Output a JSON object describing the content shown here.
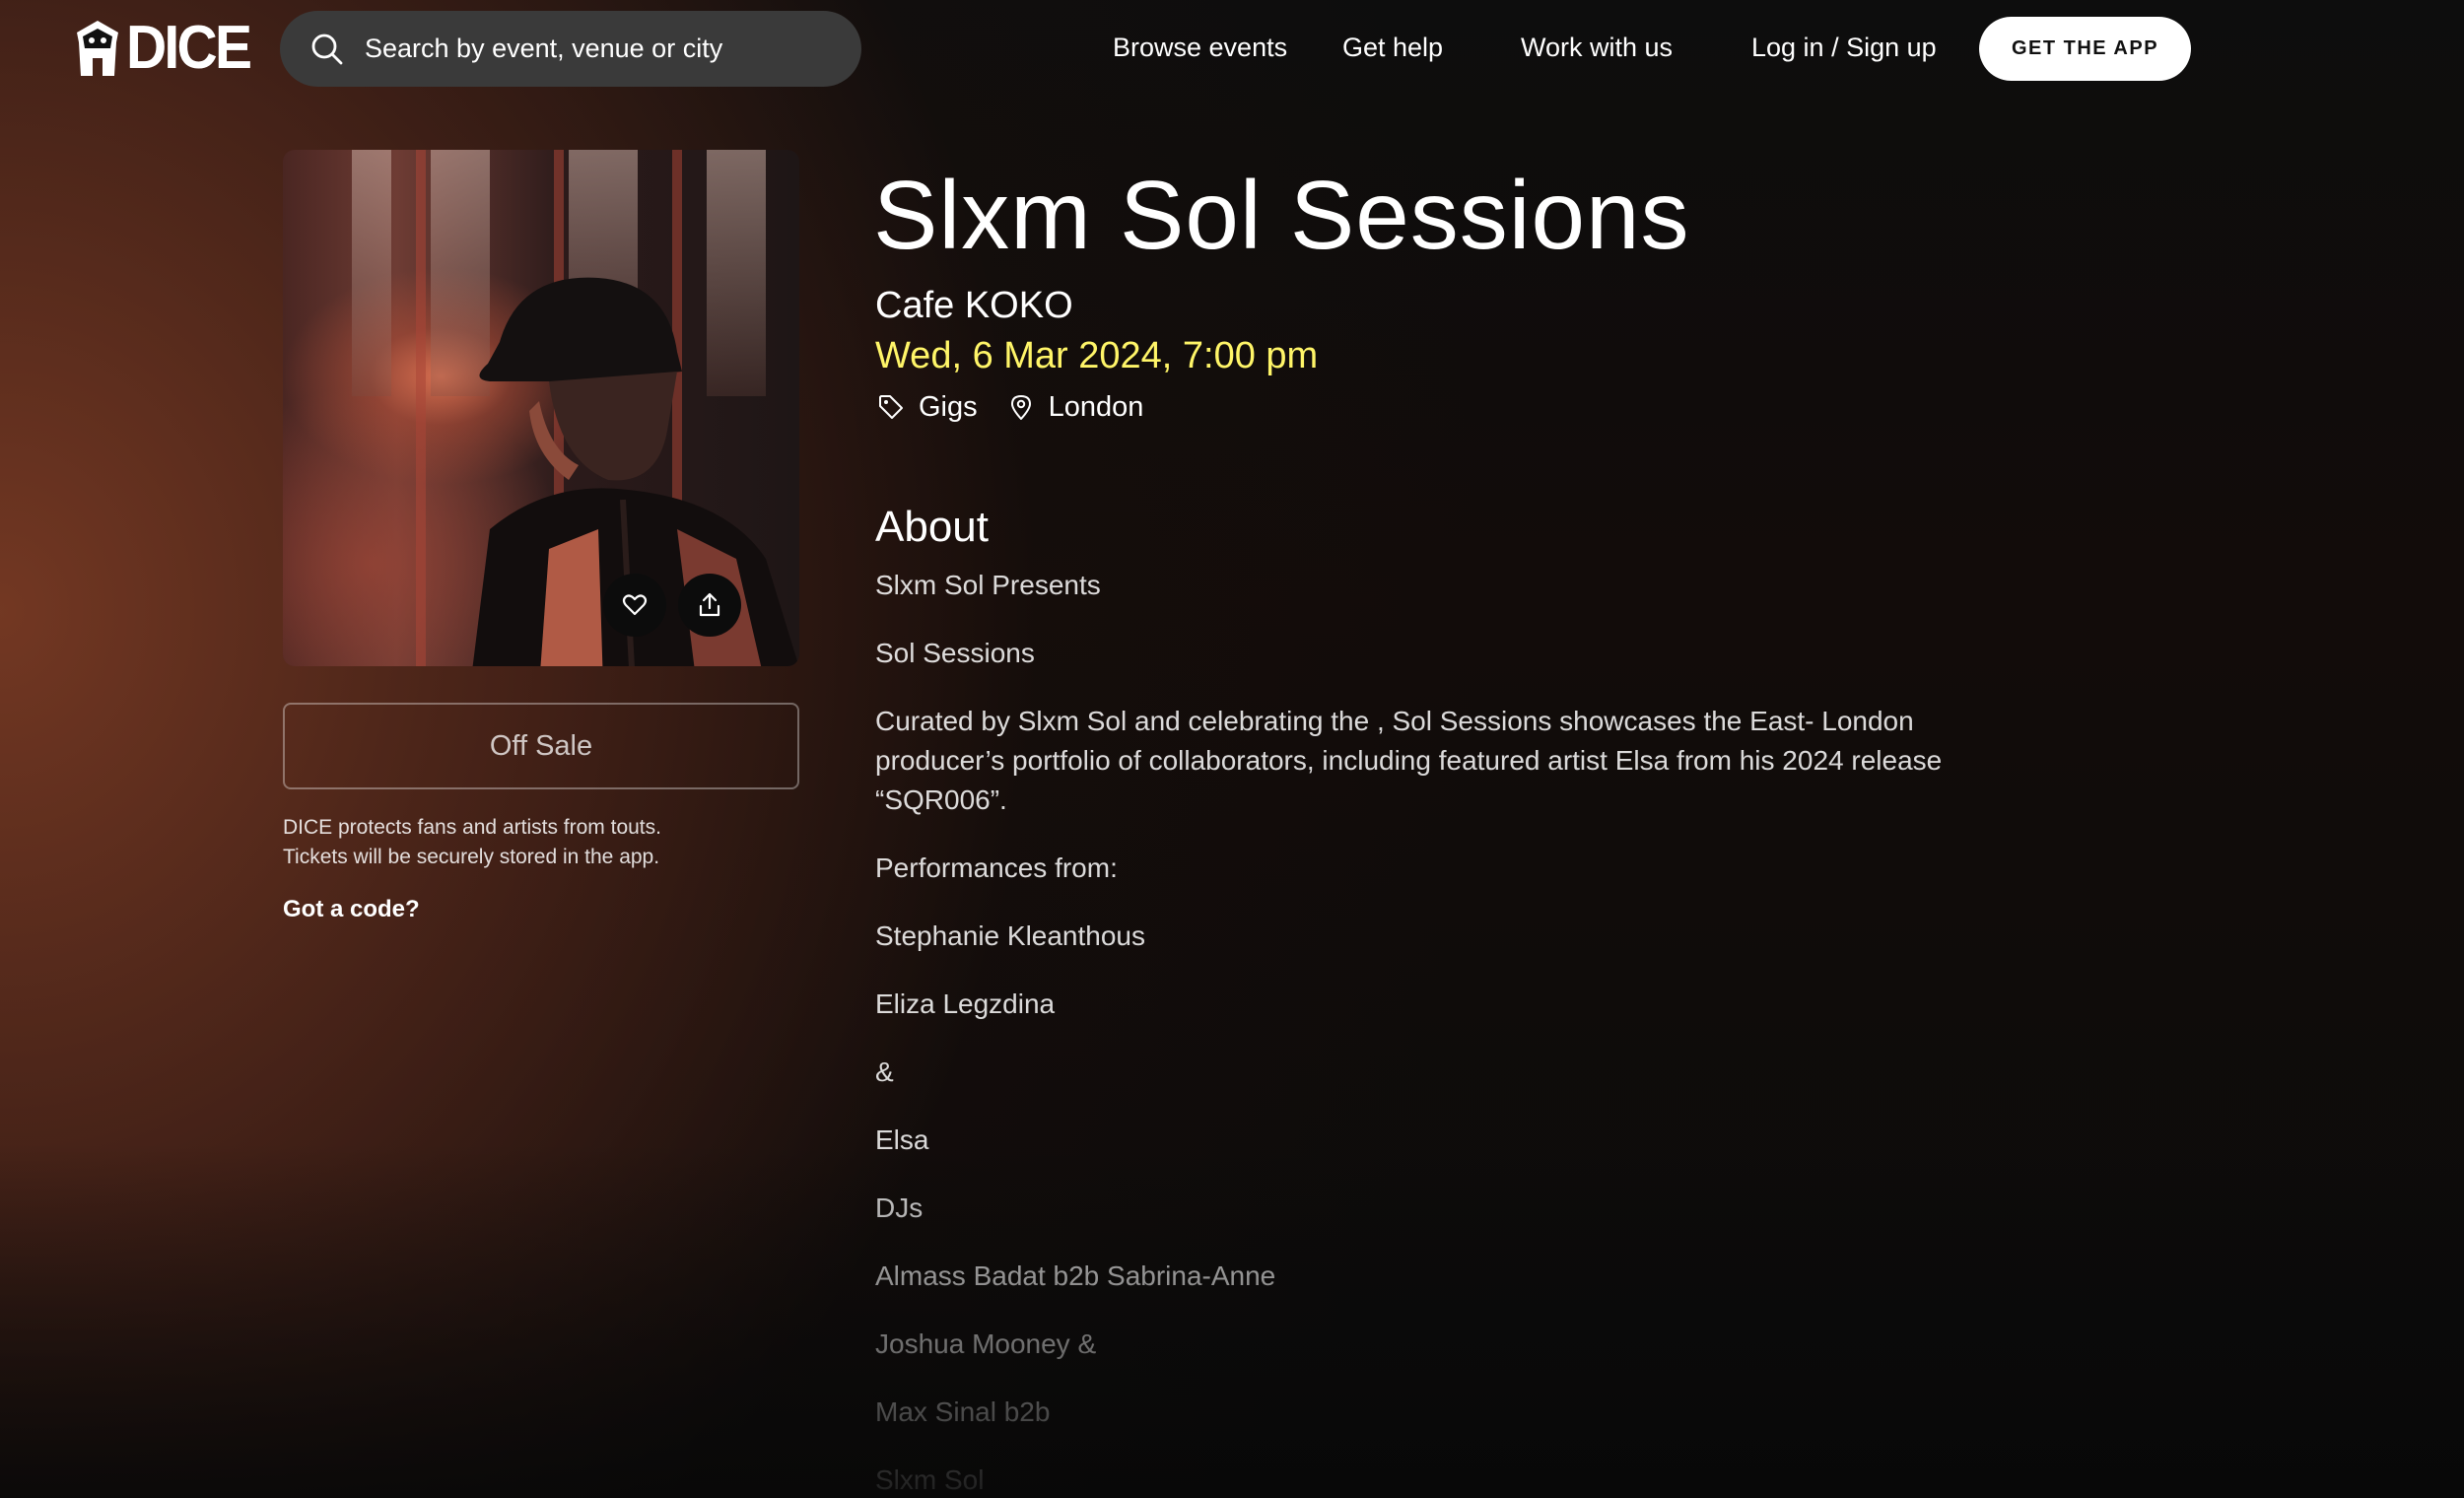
{
  "header": {
    "brand": "DICE",
    "search_placeholder": "Search by event, venue or city",
    "nav": {
      "browse": "Browse events",
      "help": "Get help",
      "work": "Work with us",
      "login": "Log in / Sign up"
    },
    "cta": "GET THE APP"
  },
  "event": {
    "title": "Slxm Sol Sessions",
    "venue": "Cafe KOKO",
    "datetime": "Wed, 6 Mar 2024, 7:00 pm",
    "category": "Gigs",
    "location": "London",
    "date_color": "#fff568"
  },
  "sidebar": {
    "ticket_status": "Off Sale",
    "protect_line1": "DICE protects fans and artists from touts.",
    "protect_line2": "Tickets will be securely stored in the app.",
    "code_link": "Got a code?"
  },
  "about": {
    "heading": "About",
    "paragraphs": [
      "Slxm Sol Presents",
      "Sol Sessions",
      "Curated by Slxm Sol and celebrating the , Sol Sessions showcases the East- London producer’s portfolio of collaborators, including featured artist Elsa from his 2024 release “SQR006”.",
      "Performances from:",
      "Stephanie Kleanthous",
      "Eliza Legzdina",
      "&",
      "Elsa",
      "DJs",
      "Almass Badat b2b Sabrina-Anne",
      "Joshua Mooney &",
      "Max Sinal b2b",
      "Slxm Sol"
    ]
  },
  "icons": {
    "logo": "dice-mascot-icon",
    "search": "search-icon",
    "favorite": "heart-icon",
    "share": "share-icon",
    "tag": "tag-icon",
    "location": "location-pin-icon"
  }
}
